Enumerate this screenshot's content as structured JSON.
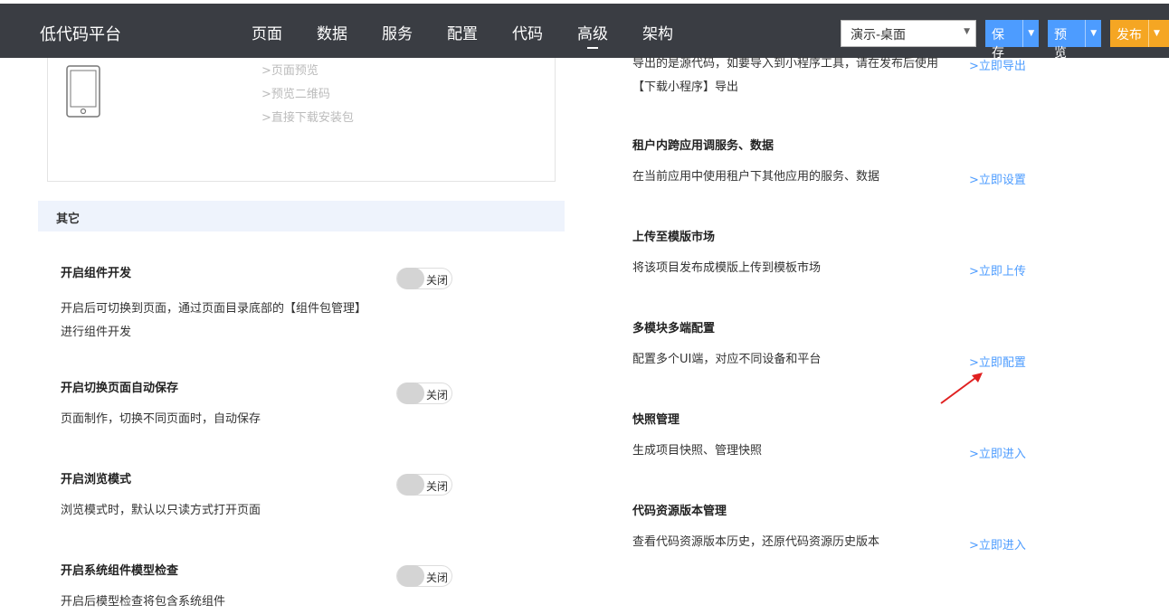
{
  "header": {
    "app_title": "低代码平台",
    "nav": [
      "页面",
      "数据",
      "服务",
      "配置",
      "代码",
      "高级",
      "架构"
    ],
    "env_select_value": "演示-桌面",
    "save_label": "保存",
    "preview_label": "预览",
    "publish_label": "发布"
  },
  "device_card": {
    "links": [
      ">页面预览",
      ">预览二维码",
      ">直接下载安装包"
    ]
  },
  "other_section": {
    "title": "其它",
    "settings": [
      {
        "title": "开启组件开发",
        "desc": "开启后可切换到页面，通过页面目录底部的【组件包管理】进行组件开发",
        "state": "关闭"
      },
      {
        "title": "开启切换页面自动保存",
        "desc": "页面制作，切换不同页面时，自动保存",
        "state": "关闭"
      },
      {
        "title": "开启浏览模式",
        "desc": "浏览模式时，默认以只读方式打开页面",
        "state": "关闭"
      },
      {
        "title": "开启系统组件模型检查",
        "desc": "开启后模型检查将包含系统组件",
        "state": "关闭"
      }
    ]
  },
  "right_panel": {
    "export_desc": "导出的是源代码，如要导入到小程序工具，请在发布后使用【下载小程序】导出",
    "export_link": ">立即导出",
    "items": [
      {
        "title": "租户内跨应用调服务、数据",
        "desc": "在当前应用中使用租户下其他应用的服务、数据",
        "link": ">立即设置"
      },
      {
        "title": "上传至模版市场",
        "desc": "将该项目发布成模版上传到模板市场",
        "link": ">立即上传"
      },
      {
        "title": "多模块多端配置",
        "desc": "配置多个UI端，对应不同设备和平台",
        "link": ">立即配置"
      },
      {
        "title": "快照管理",
        "desc": "生成项目快照、管理快照",
        "link": ">立即进入"
      },
      {
        "title": "代码资源版本管理",
        "desc": "查看代码资源版本历史，还原代码资源历史版本",
        "link": ">立即进入"
      }
    ]
  },
  "colors": {
    "header_bg": "#3a3d43",
    "accent_blue": "#4d9cff",
    "publish_orange": "#f5a623",
    "annotation_red": "#e02020"
  }
}
